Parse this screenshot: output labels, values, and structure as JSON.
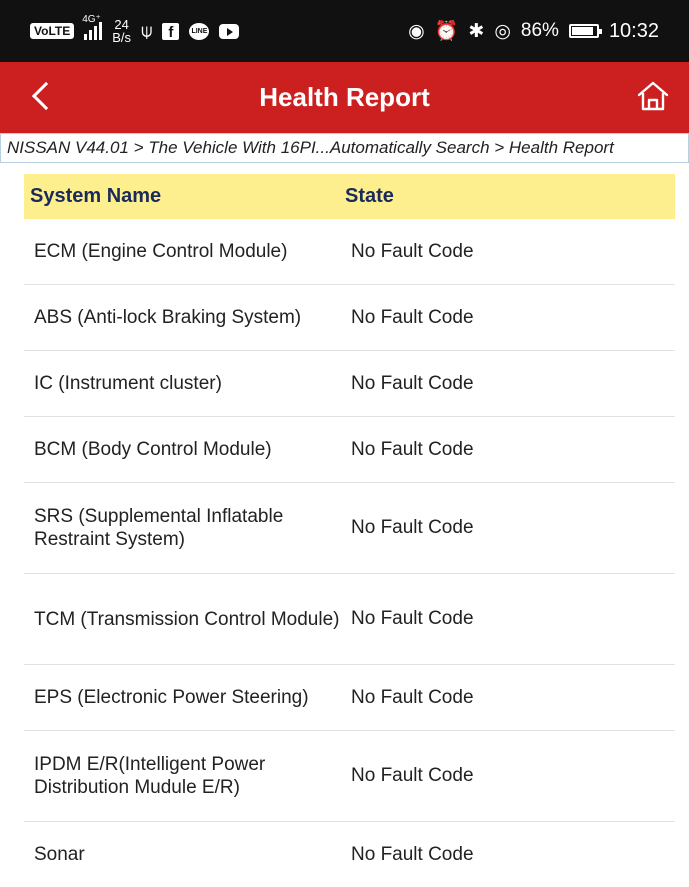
{
  "status_bar": {
    "volte": "VoLTE",
    "network": "4G⁺",
    "speed_value": "24",
    "speed_unit": "B/s",
    "battery": "86%",
    "time": "10:32",
    "icons_left": [
      "volte-icon",
      "signal-icon",
      "usb-icon",
      "facebook-icon",
      "line-icon",
      "youtube-icon"
    ],
    "icons_right": [
      "eye-icon",
      "alarm-icon",
      "bluetooth-icon",
      "location-icon",
      "battery-icon"
    ]
  },
  "app_bar": {
    "title": "Health Report",
    "background": "#cc1f1f"
  },
  "breadcrumb": "NISSAN V44.01 > The Vehicle With 16PI...Automatically Search > Health Report",
  "table": {
    "header_background": "#fdee8e",
    "columns": [
      "System Name",
      "State"
    ],
    "rows": [
      {
        "system": "ECM (Engine Control Module)",
        "state": "No Fault Code"
      },
      {
        "system": "ABS (Anti-lock Braking System)",
        "state": "No Fault Code"
      },
      {
        "system": "IC (Instrument cluster)",
        "state": "No Fault Code"
      },
      {
        "system": "BCM (Body Control Module)",
        "state": "No Fault Code"
      },
      {
        "system": "SRS (Supplemental Inflatable Restraint System)",
        "state": "No Fault Code"
      },
      {
        "system": "TCM (Transmission Control Module)",
        "state": "No Fault Code"
      },
      {
        "system": "EPS (Electronic Power Steering)",
        "state": "No Fault Code"
      },
      {
        "system": "IPDM E/R(Intelligent Power Distribution Mudule E/R)",
        "state": "No Fault Code"
      },
      {
        "system": "Sonar",
        "state": "No Fault Code"
      }
    ]
  }
}
